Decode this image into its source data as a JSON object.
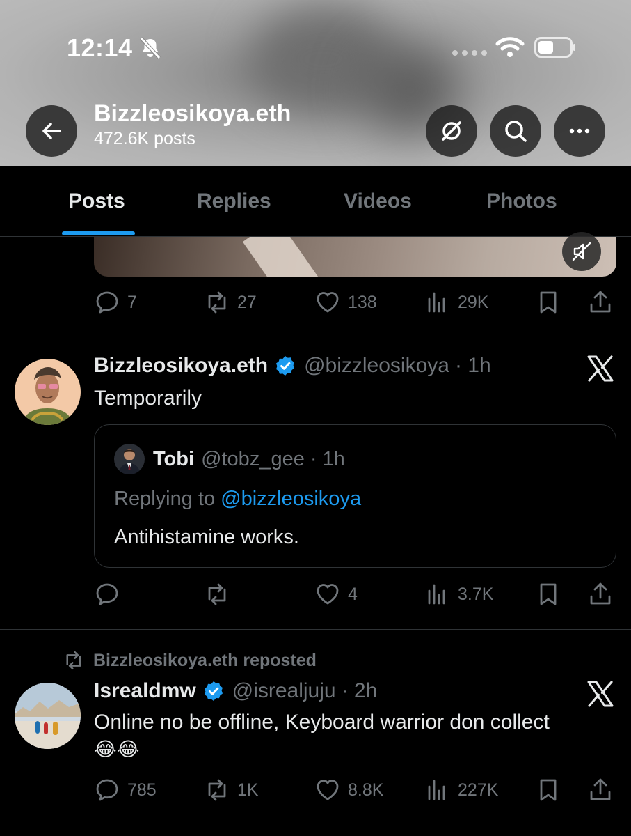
{
  "status_bar": {
    "time": "12:14"
  },
  "header": {
    "name": "Bizzleosikoya.eth",
    "post_count": "472.6K posts"
  },
  "tabs": [
    {
      "label": "Posts",
      "active": true
    },
    {
      "label": "Replies",
      "active": false
    },
    {
      "label": "Videos",
      "active": false
    },
    {
      "label": "Photos",
      "active": false
    }
  ],
  "post1_stats": {
    "replies": "7",
    "reposts": "27",
    "likes": "138",
    "views": "29K"
  },
  "post2": {
    "name": "Bizzleosikoya.eth",
    "handle": "@bizzleosikoya",
    "time": "· 1h",
    "text": "Temporarily",
    "quote": {
      "name": "Tobi",
      "handle": "@tobz_gee",
      "time": "· 1h",
      "replying_prefix": "Replying to ",
      "replying_to": "@bizzleosikoya",
      "text": "Antihistamine works."
    },
    "stats": {
      "replies": "",
      "reposts": "",
      "likes": "4",
      "views": "3.7K"
    }
  },
  "post3": {
    "reposted_by": "Bizzleosikoya.eth reposted",
    "name": "Isrealdmw",
    "handle": "@isrealjuju",
    "time": "· 2h",
    "text_line1": "Online no be offline, Keyboard warrior don collect",
    "text_line2": "😂😂",
    "stats": {
      "replies": "785",
      "reposts": "1K",
      "likes": "8.8K",
      "views": "227K"
    }
  },
  "colors": {
    "accent": "#1d9bf0",
    "muted": "#71767b",
    "text": "#e7e9ea",
    "divider": "#2f3336"
  }
}
